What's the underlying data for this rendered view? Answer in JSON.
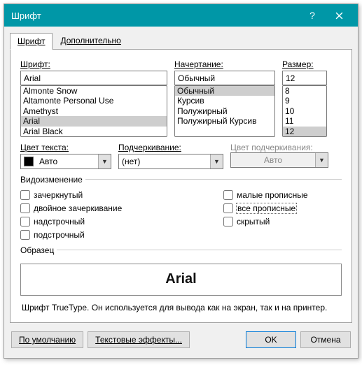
{
  "title": "Шрифт",
  "tabs": {
    "font": "Шрифт",
    "advanced": "Дополнительно"
  },
  "font": {
    "label": "Шрифт:",
    "value": "Arial",
    "options": [
      "Almonte Snow",
      "Altamonte Personal Use",
      "Amethyst",
      "Arial",
      "Arial Black"
    ],
    "selected": "Arial"
  },
  "style": {
    "label": "Начертание:",
    "value": "Обычный",
    "options": [
      "Обычный",
      "Курсив",
      "Полужирный",
      "Полужирный Курсив"
    ],
    "selected": "Обычный"
  },
  "size": {
    "label": "Размер:",
    "value": "12",
    "options": [
      "8",
      "9",
      "10",
      "11",
      "12"
    ],
    "selected": "12"
  },
  "color": {
    "label": "Цвет текста:",
    "value": "Авто"
  },
  "underline": {
    "label": "Подчеркивание:",
    "value": "(нет)"
  },
  "ulcolor": {
    "label": "Цвет подчеркивания:",
    "value": "Авто"
  },
  "effects": {
    "legend": "Видоизменение",
    "strike": "зачеркнутый",
    "dstrike": "двойное зачеркивание",
    "superscript": "надстрочный",
    "subscript": "подстрочный",
    "smallcaps": "малые прописные",
    "allcaps": "все прописные",
    "hidden": "скрытый"
  },
  "preview": {
    "legend": "Образец",
    "text": "Arial"
  },
  "note": "Шрифт TrueType. Он используется для вывода как на экран, так и на принтер.",
  "buttons": {
    "default": "По умолчанию",
    "effects": "Текстовые эффекты...",
    "ok": "OK",
    "cancel": "Отмена"
  }
}
